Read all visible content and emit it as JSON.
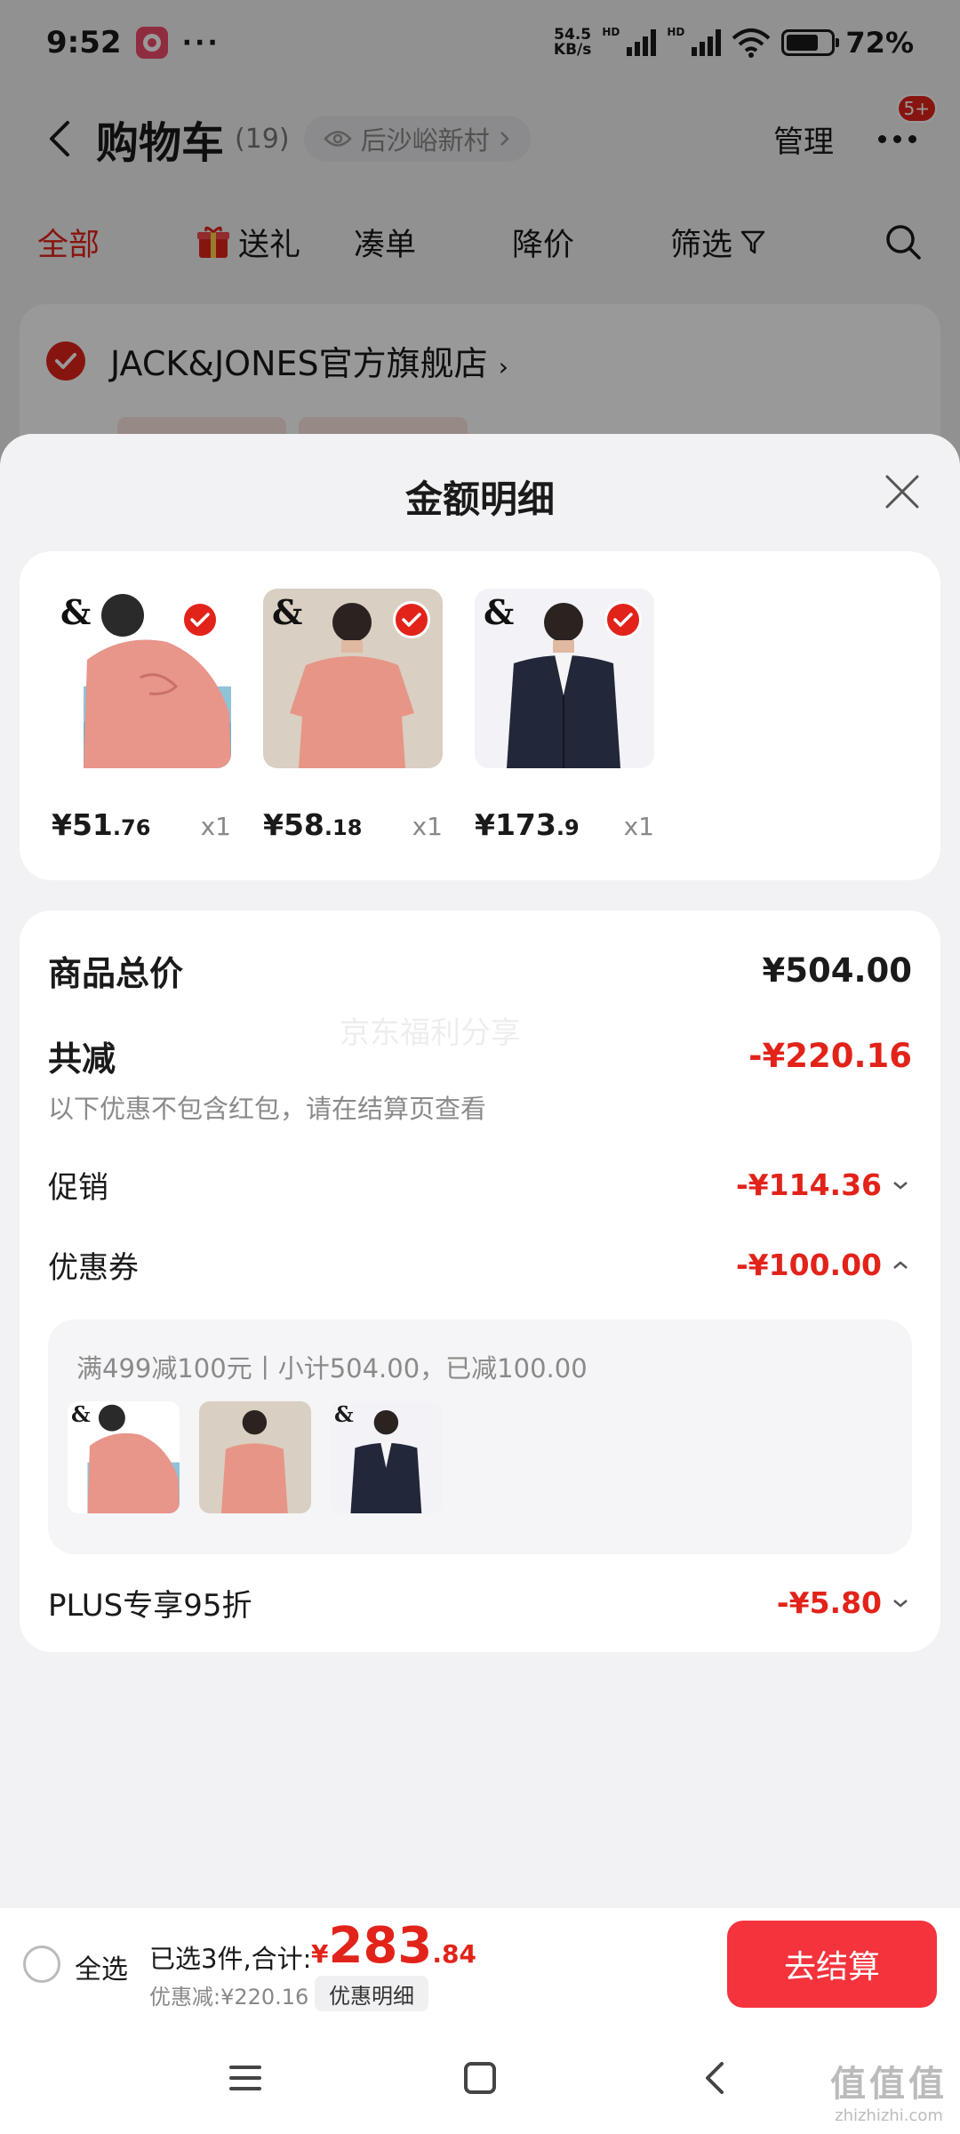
{
  "status_bar": {
    "time": "9:52",
    "app_icon": "app-badge-icon",
    "app_icon_text": "",
    "dots": "···",
    "speed_top": "54.5",
    "speed_bottom": "KB/s",
    "hd1": "HD",
    "hd2": "HD",
    "battery_percent": "72%",
    "battery_level": 0.72
  },
  "header": {
    "title": "购物车",
    "count": "(19)",
    "location": "后沙峪新村",
    "manage": "管理",
    "more_badge": "5+"
  },
  "tabs": [
    {
      "label": "全部"
    },
    {
      "label": "送礼"
    },
    {
      "label": "凑单"
    },
    {
      "label": "降价"
    },
    {
      "label": "筛选"
    }
  ],
  "store": {
    "name": "JACK&JONES官方旗舰店",
    "arrow": "›"
  },
  "sheet": {
    "title": "金额明细",
    "products": [
      {
        "logo": "&",
        "price_int": "¥51",
        "price_dec": ".76",
        "qty": "x1",
        "color": "#e8958a"
      },
      {
        "logo": "&",
        "price_int": "¥58",
        "price_dec": ".18",
        "qty": "x1",
        "color": "#e79586"
      },
      {
        "logo": "&",
        "price_int": "¥173",
        "price_dec": ".9",
        "qty": "x1",
        "color": "#22273a"
      }
    ],
    "total_label": "商品总价",
    "total_value": "¥504.00",
    "reduce_label": "共减",
    "reduce_value": "-¥220.16",
    "reduce_note": "以下优惠不包含红包，请在结算页查看",
    "watermark": "京东福利分享",
    "promo_label": "促销",
    "promo_value": "-¥114.36",
    "coupon_label": "优惠券",
    "coupon_value": "-¥100.00",
    "coupon_detail": "满499减100元丨小计504.00，已减100.00",
    "plus_label": "PLUS专享95折",
    "plus_value": "-¥5.80"
  },
  "checkout": {
    "select_all": "全选",
    "summary": "已选3件,合计:",
    "currency": "¥",
    "amount_int": "283",
    "amount_dec": ".84",
    "discount": "优惠减:¥220.16",
    "detail_button": "优惠明细",
    "pay_button": "去结算"
  },
  "corner_watermark": {
    "big": "值值值",
    "small": "zhizhizhi.com"
  },
  "colors": {
    "accent_red": "#e2231a",
    "pay_red": "#f4333c",
    "background": "#f2f2f4"
  }
}
